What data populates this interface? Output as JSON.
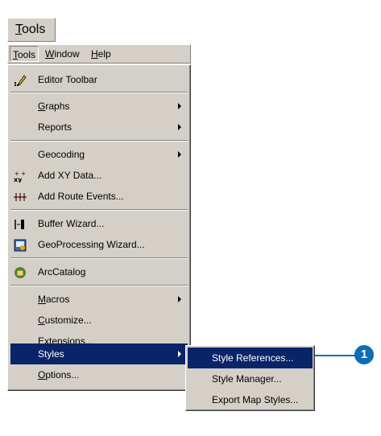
{
  "caption": {
    "first": "T",
    "rest": "ools"
  },
  "menubar": [
    {
      "first": "T",
      "rest": "ools"
    },
    {
      "first": "W",
      "rest": "indow"
    },
    {
      "first": "H",
      "rest": "elp"
    }
  ],
  "tools_menu": {
    "editor_toolbar": "Editor Toolbar",
    "graphs": {
      "first": "G",
      "rest": "raphs"
    },
    "reports": "Reports",
    "geocoding": "Geocoding",
    "add_xy_data": "Add XY Data...",
    "add_route_events": "Add Route Events...",
    "buffer_wizard": "Buffer Wizard...",
    "geoprocessing_wizard": "GeoProcessing Wizard...",
    "arccatalog": "ArcCatalog",
    "macros": {
      "first": "M",
      "rest": "acros"
    },
    "customize": {
      "first": "C",
      "rest": "ustomize..."
    },
    "extensions": "Extensions...",
    "styles": "Styles",
    "options": {
      "first": "O",
      "rest": "ptions..."
    }
  },
  "styles_menu": {
    "style_references": "Style References...",
    "style_manager": "Style Manager...",
    "export_map_styles": "Export Map Styles..."
  },
  "callout": {
    "number": "1"
  },
  "colors": {
    "selection": "#0a246a",
    "menu_bg": "#d4d0c8",
    "callout": "#0e6db4"
  },
  "icons": {
    "editor_toolbar": "pencil-icon",
    "add_xy_data": "xy-data-icon",
    "add_route_events": "route-events-icon",
    "buffer_wizard": "buffer-wizard-icon",
    "geoprocessing_wizard": "geoprocessing-icon",
    "arccatalog": "arccatalog-icon"
  }
}
